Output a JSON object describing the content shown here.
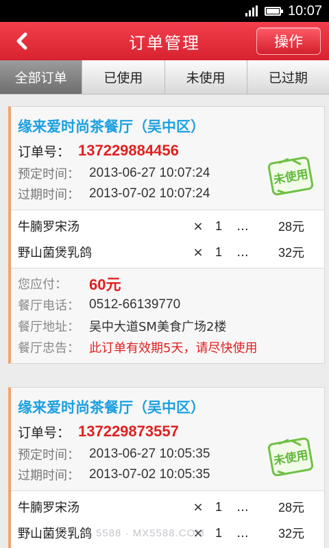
{
  "status_bar": {
    "time": "10:07"
  },
  "header": {
    "back_icon": "back-arrow-icon",
    "title": "订单管理",
    "action_label": "操作"
  },
  "tabs": [
    {
      "label": "全部订单",
      "active": true
    },
    {
      "label": "已使用",
      "active": false
    },
    {
      "label": "未使用",
      "active": false
    },
    {
      "label": "已过期",
      "active": false
    }
  ],
  "orders": [
    {
      "restaurant": "缘来爱时尚茶餐厅（吴中区）",
      "order_label": "订单号：",
      "order_no": "137229884456",
      "book_label": "预定时间：",
      "book_time": "2013-06-27 10:07:24",
      "expire_label": "过期时间：",
      "expire_time": "2013-07-02 10:07:24",
      "stamp": "未使用",
      "items": [
        {
          "name": "牛腩罗宋汤",
          "x": "×",
          "qty": "1",
          "dots": "...",
          "price": "28元"
        },
        {
          "name": "野山菌煲乳鸽",
          "x": "×",
          "qty": "1",
          "dots": "...",
          "price": "32元"
        }
      ],
      "pay_label": "您应付：",
      "pay": "60元",
      "phone_label": "餐厅电话：",
      "phone": "0512-66139770",
      "addr_label": "餐厅地址：",
      "addr": "吴中大道SM美食广场2楼",
      "notice_label": "餐厅忠告：",
      "notice": "此订单有效期5天，请尽快使用"
    },
    {
      "restaurant": "缘来爱时尚茶餐厅（吴中区）",
      "order_label": "订单号：",
      "order_no": "137229873557",
      "book_label": "预定时间：",
      "book_time": "2013-06-27 10:05:35",
      "expire_label": "过期时间：",
      "expire_time": "2013-07-02 10:05:35",
      "stamp": "未使用",
      "items": [
        {
          "name": "牛腩罗宋汤",
          "x": "×",
          "qty": "1",
          "dots": "...",
          "price": "28元"
        },
        {
          "name": "野山菌煲乳鸽",
          "x": "×",
          "qty": "1",
          "dots": "...",
          "price": "32元"
        }
      ]
    }
  ],
  "watermark": "5588 · MX5588.COM",
  "colors": {
    "brand_red": "#e0222f",
    "name_blue": "#1ca0e0",
    "alert_red": "#e02020",
    "stamp_green": "#5fb83a"
  }
}
